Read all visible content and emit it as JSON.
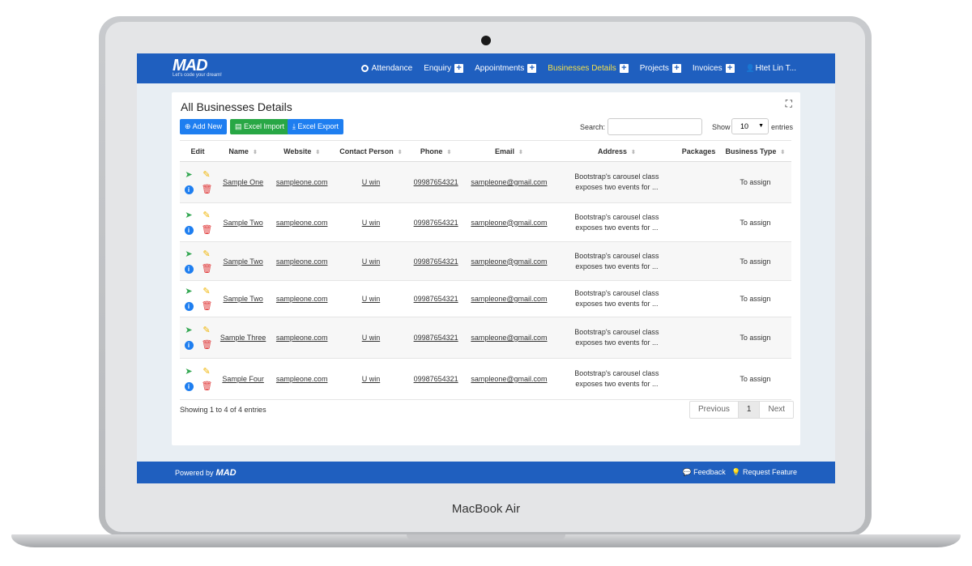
{
  "device": {
    "label": "MacBook Air"
  },
  "navbar": {
    "logo_text": "MAD",
    "logo_tagline": "Let's code your dream!",
    "items": [
      {
        "label": "Attendance",
        "icon": "clock-icon",
        "plus": false,
        "active": false
      },
      {
        "label": "Enquiry",
        "plus": true,
        "active": false
      },
      {
        "label": "Appointments",
        "plus": true,
        "active": false
      },
      {
        "label": "Businesses Details",
        "plus": true,
        "active": true
      },
      {
        "label": "Projects",
        "plus": true,
        "active": false
      },
      {
        "label": "Invoices",
        "plus": true,
        "active": false
      }
    ],
    "user": "Htet Lin T...",
    "active_color": "#f5e04a",
    "bar_color": "#1f5fbf"
  },
  "page": {
    "title": "All Businesses Details",
    "buttons": {
      "add": "Add New",
      "import": "Excel Import",
      "export": "Excel Export"
    },
    "search_label": "Search:",
    "search_value": "",
    "show_label": "Show",
    "show_value": "10",
    "entries_label": "entries"
  },
  "table": {
    "columns": [
      "Edit",
      "Name",
      "Website",
      "Contact Person",
      "Phone",
      "Email",
      "Address",
      "Packages",
      "Business Type"
    ],
    "rows": [
      {
        "name": "Sample One",
        "website": "sampleone.com",
        "contact": "U win",
        "phone": "09987654321",
        "email": "sampleone@gmail.com",
        "address": "Bootstrap's carousel class exposes two events for ...",
        "packages": "",
        "type": "To assign"
      },
      {
        "name": "Sample Two",
        "website": "sampleone.com",
        "contact": "U win",
        "phone": "09987654321",
        "email": "sampleone@gmail.com",
        "address": "Bootstrap's carousel class exposes two events for ...",
        "packages": "",
        "type": "To assign"
      },
      {
        "name": "Sample Two",
        "website": "sampleone.com",
        "contact": "U win",
        "phone": "09987654321",
        "email": "sampleone@gmail.com",
        "address": "Bootstrap's carousel class exposes two events for ...",
        "packages": "",
        "type": "To assign"
      },
      {
        "name": "Sample Two",
        "website": "sampleone.com",
        "contact": "U win",
        "phone": "09987654321",
        "email": "sampleone@gmail.com",
        "address": "Bootstrap's carousel class exposes two events for ...",
        "packages": "",
        "type": "To assign"
      },
      {
        "name": "Sample Three",
        "website": "sampleone.com",
        "contact": "U win",
        "phone": "09987654321",
        "email": "sampleone@gmail.com",
        "address": "Bootstrap's carousel class exposes two events for ...",
        "packages": "",
        "type": "To assign"
      },
      {
        "name": "Sample Four",
        "website": "sampleone.com",
        "contact": "U win",
        "phone": "09987654321",
        "email": "sampleone@gmail.com",
        "address": "Bootstrap's carousel class exposes two events for ...",
        "packages": "",
        "type": "To assign"
      }
    ]
  },
  "pagination": {
    "info": "Showing 1 to 4 of 4 entries",
    "previous": "Previous",
    "current": "1",
    "next": "Next"
  },
  "footer": {
    "powered_by": "Powered by",
    "logo_text": "MAD",
    "feedback": "Feedback",
    "request": "Request Feature"
  }
}
